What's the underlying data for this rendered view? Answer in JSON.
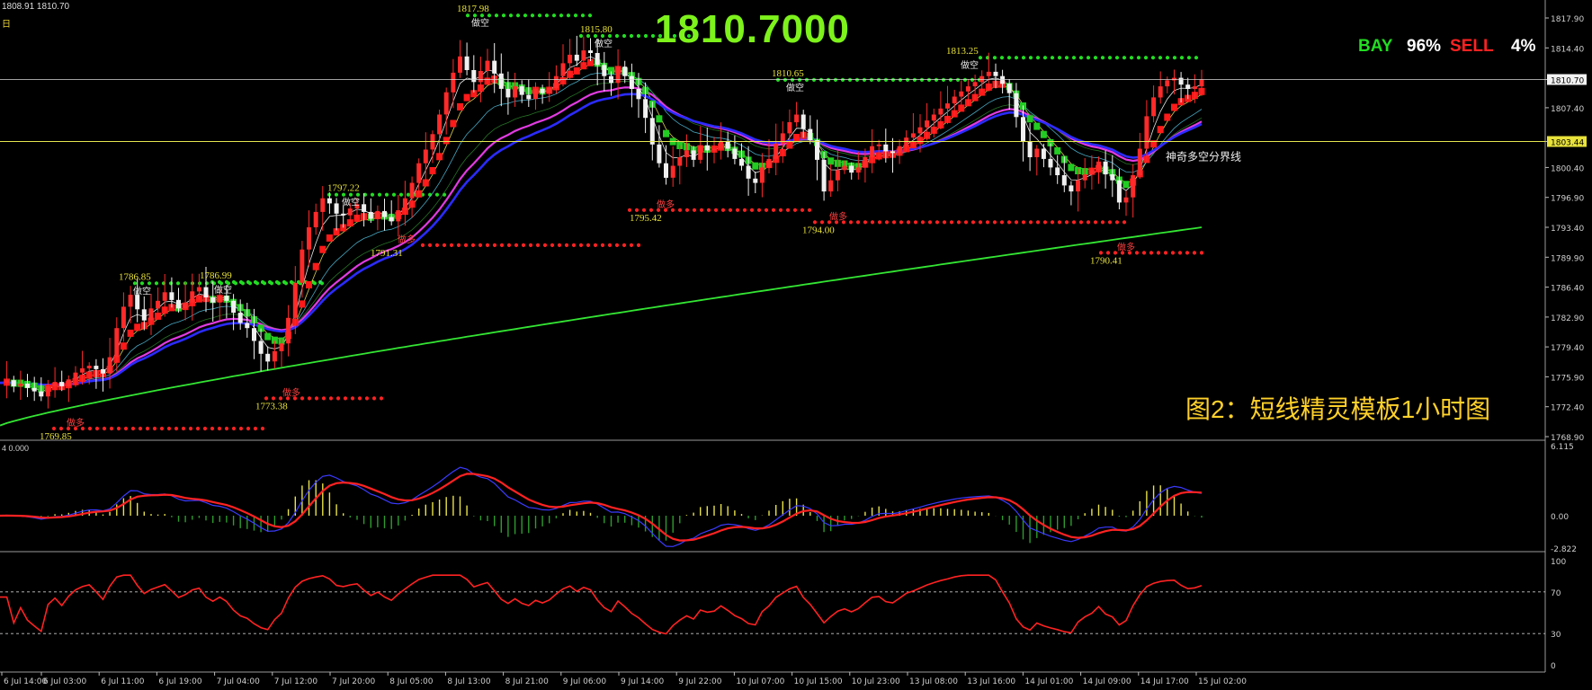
{
  "header": {
    "ohlc_text": "1808.91 1810.70",
    "timeframe_mark": "日"
  },
  "big_price": "1810.7000",
  "signal": {
    "buy_label": "BAY",
    "buy_pct": "96%",
    "sell_label": "SELL",
    "sell_pct": "4%"
  },
  "chart_title": "图2：短线精灵模板1小时图",
  "boundary_label": "神奇多空分界线",
  "macd_label": "4 0.000",
  "colors": {
    "bull": "#ff2a2a",
    "bear": "#f0f0f0",
    "ribbon_up": "#ff1a1a",
    "ribbon_down": "#22cc22",
    "ma_blue": "#2b2bff",
    "ma_magenta": "#e13be1",
    "ma_green": "#33e633",
    "resistance": "#22dd22",
    "support": "#ff2222",
    "price_line": "#d8d8d8",
    "boundary_line": "#e6e650"
  },
  "chart_data": [
    {
      "type": "candlestick",
      "title": "",
      "y_ticks": [
        "1817.90",
        "1814.40",
        "1810.70",
        "1807.40",
        "1803.44",
        "1800.40",
        "1796.90",
        "1793.40",
        "1789.90",
        "1786.40",
        "1782.90",
        "1779.40",
        "1775.90",
        "1772.40",
        "1768.90"
      ],
      "ylim": [
        1768.9,
        1819.5
      ],
      "current_price": "1810.70",
      "boundary_price": "1803.44",
      "x_ticks": [
        "6 Jul 14:00",
        "6 Jul 03:00",
        "6 Jul 11:00",
        "6 Jul 19:00",
        "7 Jul 04:00",
        "7 Jul 12:00",
        "7 Jul 20:00",
        "8 Jul 05:00",
        "8 Jul 13:00",
        "8 Jul 21:00",
        "9 Jul 06:00",
        "9 Jul 14:00",
        "9 Jul 22:00",
        "10 Jul 07:00",
        "10 Jul 15:00",
        "10 Jul 23:00",
        "13 Jul 08:00",
        "13 Jul 16:00",
        "14 Jul 01:00",
        "14 Jul 09:00",
        "14 Jul 17:00",
        "15 Jul 02:00"
      ],
      "close_path": [
        1775.2,
        1775.5,
        1774.8,
        1775.1,
        1774.6,
        1774.2,
        1773.6,
        1774.8,
        1775.3,
        1774.8,
        1775.6,
        1776.4,
        1776.9,
        1777.2,
        1776.8,
        1776.3,
        1778.2,
        1781.6,
        1784.1,
        1785.5,
        1783.8,
        1782.5,
        1783.9,
        1784.8,
        1785.8,
        1784.9,
        1783.9,
        1784.6,
        1785.9,
        1786.4,
        1785.2,
        1784.6,
        1785.4,
        1784.8,
        1783.4,
        1782.2,
        1781.6,
        1780.1,
        1778.6,
        1777.7,
        1778.9,
        1779.8,
        1782.8,
        1786.9,
        1790.8,
        1793.4,
        1795.2,
        1796.8,
        1796.2,
        1795.0,
        1794.8,
        1795.6,
        1796.1,
        1795.2,
        1794.4,
        1795.3,
        1794.6,
        1794.1,
        1795.4,
        1796.8,
        1798.6,
        1800.9,
        1802.5,
        1804.3,
        1806.6,
        1809.2,
        1811.5,
        1813.4,
        1811.8,
        1810.4,
        1811.7,
        1812.9,
        1811.4,
        1809.6,
        1808.6,
        1809.9,
        1808.9,
        1808.4,
        1809.6,
        1809.1,
        1809.7,
        1811.1,
        1812.6,
        1813.6,
        1812.9,
        1814.1,
        1813.8,
        1812.4,
        1811.1,
        1810.3,
        1812.2,
        1811.1,
        1809.6,
        1808.4,
        1806.2,
        1803.1,
        1800.9,
        1799.2,
        1800.6,
        1801.6,
        1802.4,
        1801.3,
        1803.0,
        1802.4,
        1802.6,
        1803.5,
        1802.6,
        1801.4,
        1800.6,
        1799.1,
        1798.6,
        1800.4,
        1801.4,
        1803.2,
        1804.4,
        1805.7,
        1806.6,
        1804.9,
        1803.6,
        1801.3,
        1797.6,
        1798.9,
        1800.1,
        1800.6,
        1799.8,
        1800.4,
        1801.6,
        1802.9,
        1803.1,
        1802.3,
        1802.1,
        1802.9,
        1803.9,
        1804.4,
        1805.1,
        1805.9,
        1806.6,
        1807.3,
        1807.9,
        1808.7,
        1809.3,
        1809.9,
        1810.4,
        1811.1,
        1811.6,
        1811.1,
        1810.2,
        1809.1,
        1806.3,
        1803.4,
        1801.6,
        1802.6,
        1801.4,
        1800.4,
        1799.5,
        1798.3,
        1797.6,
        1798.9,
        1799.6,
        1800.1,
        1801.1,
        1799.6,
        1798.9,
        1796.3,
        1796.9,
        1799.5,
        1802.6,
        1806.4,
        1808.6,
        1809.9,
        1810.6,
        1810.9,
        1810.1,
        1809.6,
        1809.9,
        1810.7
      ],
      "ma_blue_fn": "moving average 60",
      "ma_green_fn": "moving average 200",
      "resistance_levels": [
        {
          "label": "1786.85"
        },
        {
          "label": "1786.99"
        },
        {
          "label": "1797.22"
        },
        {
          "label": "1817.98"
        },
        {
          "label": "1815.80"
        },
        {
          "label": "1810.65"
        },
        {
          "label": "1813.25"
        }
      ],
      "support_levels": [
        {
          "label": "1769.85"
        },
        {
          "label": "1773.38"
        },
        {
          "label": "1791.31"
        },
        {
          "label": "1795.42"
        },
        {
          "label": "1794.00"
        },
        {
          "label": "1790.41"
        }
      ],
      "marker_labels": {
        "short": "做空",
        "long": "做多"
      }
    },
    {
      "type": "macd",
      "y_ticks": [
        "6.115",
        "0.00",
        "-2.822"
      ],
      "ylim": [
        -2.822,
        6.115
      ]
    },
    {
      "type": "line",
      "y_ticks": [
        "100",
        "70",
        "30",
        "0"
      ],
      "ylim": [
        0,
        100
      ],
      "levels": [
        70,
        30
      ]
    }
  ]
}
